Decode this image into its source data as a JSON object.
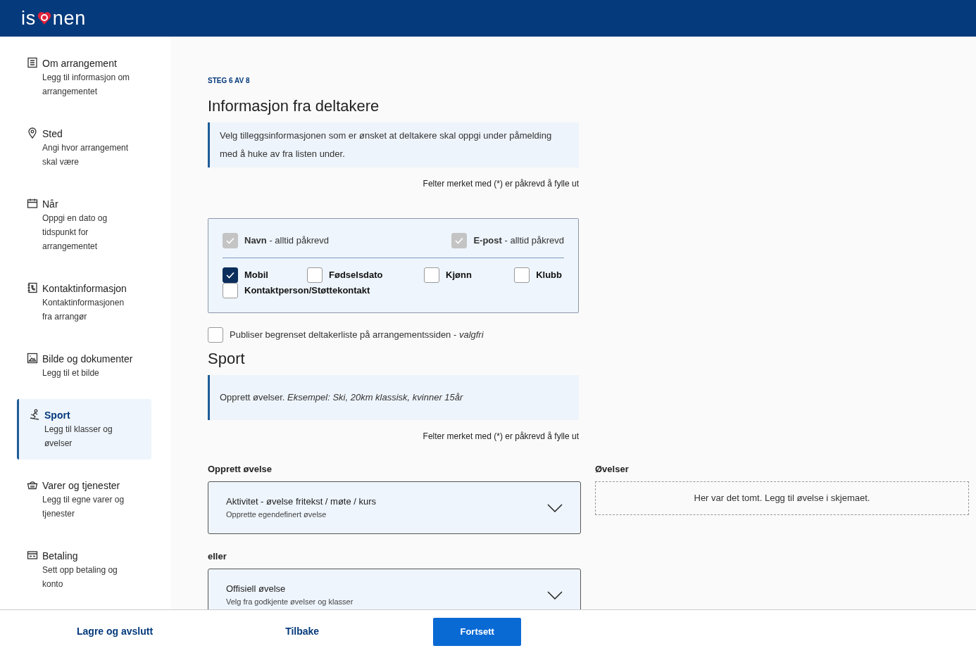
{
  "header": {
    "logo_start": "is",
    "logo_end": "nen"
  },
  "sidebar": {
    "items": [
      {
        "title": "Om arrangement",
        "subtitle": "Legg til informasjon om arrangementet",
        "selected": false
      },
      {
        "title": "Sted",
        "subtitle": "Angi hvor arrangement skal være",
        "selected": false
      },
      {
        "title": "Når",
        "subtitle": "Oppgi en dato og tidspunkt for arrangementet",
        "selected": false
      },
      {
        "title": "Kontaktinformasjon",
        "subtitle": "Kontaktinformasjonen fra arrangør",
        "selected": false
      },
      {
        "title": "Bilde og dokumenter",
        "subtitle": "Legg til et bilde",
        "selected": false
      },
      {
        "title": "Sport",
        "subtitle": "Legg til klasser og øvelser",
        "selected": true
      },
      {
        "title": "Varer og tjenester",
        "subtitle": "Legg til egne varer og tjenester",
        "selected": false
      },
      {
        "title": "Betaling",
        "subtitle": "Sett opp betaling og konto",
        "selected": false
      }
    ]
  },
  "step": "STEG 6 AV 8",
  "participants": {
    "title": "Informasjon fra deltakere",
    "info": "Velg tilleggsinformasjonen som er ønsket at deltakere skal oppgi under påmelding med å huke av fra listen under.",
    "required_note": "Felter merket med (*) er påkrevd å fylle ut",
    "required_fields": [
      {
        "label": "**Navn** - alltid påkrevd",
        "checked": true,
        "disabled": true
      },
      {
        "label": "**E-post** - alltid påkrevd",
        "checked": true,
        "disabled": true
      }
    ],
    "optional_fields": [
      {
        "label": "Mobil",
        "checked": true
      },
      {
        "label": "Fødselsdato",
        "checked": false
      },
      {
        "label": "Kjønn",
        "checked": false
      },
      {
        "label": "Klubb",
        "checked": false
      },
      {
        "label": "Kontaktperson/Støttekontakt",
        "checked": false
      }
    ],
    "publish": {
      "label": "Publiser begrenset deltakerliste på arrangementssiden - *valgfri*",
      "checked": false
    }
  },
  "sport": {
    "title": "Sport",
    "info": "Opprett øvelser. *Eksempel: Ski, 20km klassisk, kvinner 15år*",
    "required_note": "Felter merket med (*) er påkrevd å fylle ut",
    "create_label": "Opprett øvelse",
    "separator": "eller",
    "dropdowns": [
      {
        "title": "Aktivitet - øvelse fritekst / møte / kurs",
        "subtitle": "Opprette egendefinert øvelse",
        "expanded": false
      },
      {
        "title": "Offisiell øvelse",
        "subtitle": "Velg fra godkjente øvelser og klasser",
        "expanded": false
      }
    ],
    "list_label": "Øvelser",
    "empty_text": "Her var det tomt. Legg til øvelse i skjemaet."
  },
  "footer": {
    "buttons": [
      {
        "label": "Lagre og avslutt",
        "kind": "link"
      },
      {
        "label": "Tilbake",
        "kind": "link"
      },
      {
        "label": "Fortsett",
        "kind": "primary"
      }
    ]
  }
}
